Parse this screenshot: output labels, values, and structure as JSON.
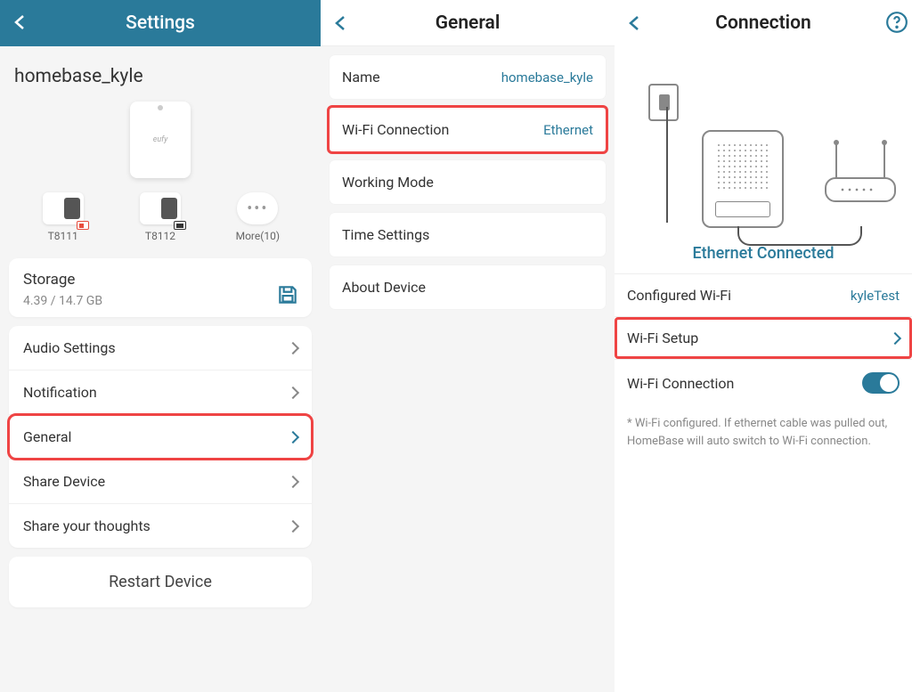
{
  "panel1": {
    "title": "Settings",
    "device_name": "homebase_kyle",
    "icons": [
      {
        "label": "T8111"
      },
      {
        "label": "T8112"
      },
      {
        "label": "More(10)"
      }
    ],
    "storage": {
      "label": "Storage",
      "value": "4.39 / 14.7 GB"
    },
    "menu": [
      {
        "label": "Audio Settings"
      },
      {
        "label": "Notification"
      },
      {
        "label": "General"
      },
      {
        "label": "Share Device"
      },
      {
        "label": "Share your thoughts"
      }
    ],
    "restart": "Restart Device",
    "highlight_index": 2
  },
  "panel2": {
    "title": "General",
    "rows": [
      {
        "label": "Name",
        "value": "homebase_kyle"
      },
      {
        "label": "Wi-Fi Connection",
        "value": "Ethernet"
      },
      {
        "label": "Working Mode",
        "value": ""
      },
      {
        "label": "Time Settings",
        "value": ""
      },
      {
        "label": "About Device",
        "value": ""
      }
    ],
    "highlight_index": 1
  },
  "panel3": {
    "title": "Connection",
    "status": "Ethernet Connected",
    "configured_wifi": {
      "label": "Configured Wi-Fi",
      "value": "kyleTest"
    },
    "wifi_setup": {
      "label": "Wi-Fi Setup"
    },
    "wifi_connection": {
      "label": "Wi-Fi Connection",
      "on": true
    },
    "note": "* Wi-Fi configured. If ethernet cable was pulled out, HomeBase will auto switch to Wi-Fi connection."
  }
}
